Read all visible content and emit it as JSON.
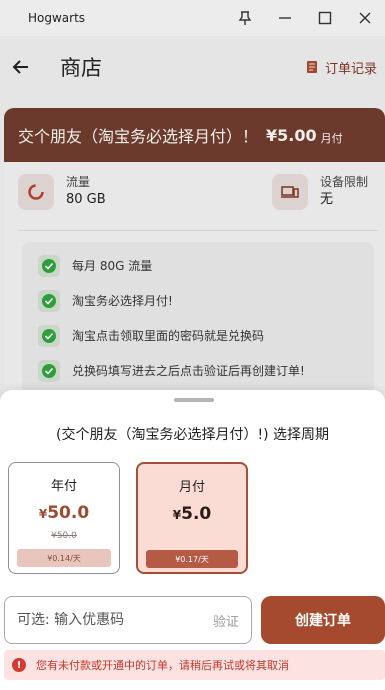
{
  "window": {
    "title": "Hogwarts"
  },
  "header": {
    "title": "商店",
    "orders_label": "订单记录"
  },
  "plan": {
    "name": "交个朋友（淘宝务必选择月付）！",
    "price": "¥5.00",
    "unit": "月付",
    "traffic_label": "流量",
    "traffic_value": "80 GB",
    "device_label": "设备限制",
    "device_value": "无",
    "features": [
      "每月 80G 流量",
      "淘宝务必选择月付!",
      "淘宝点击领取里面的密码就是兑换码",
      "兑换码填写进去之后点击验证后再创建订单!"
    ]
  },
  "sheet": {
    "title": "(交个朋友（淘宝务必选择月付）!) 选择周期",
    "periods": [
      {
        "name": "年付",
        "currency": "¥",
        "price": "50.0",
        "original": "¥50.0",
        "per_day": "¥0.14/天",
        "selected": false
      },
      {
        "name": "月付",
        "currency": "¥",
        "price": "5.0",
        "per_day": "¥0.17/天",
        "selected": true
      }
    ],
    "coupon_placeholder": "可选: 输入优惠码",
    "verify_label": "验证",
    "create_label": "创建订单",
    "alert": "您有未付款或开通中的订单，请稍后再试或将其取消"
  },
  "colors": {
    "accent": "#a5492f",
    "plan_header": "#6b3a2c",
    "selected_bg": "#fbdcd4",
    "alert_text": "#c0392b"
  }
}
